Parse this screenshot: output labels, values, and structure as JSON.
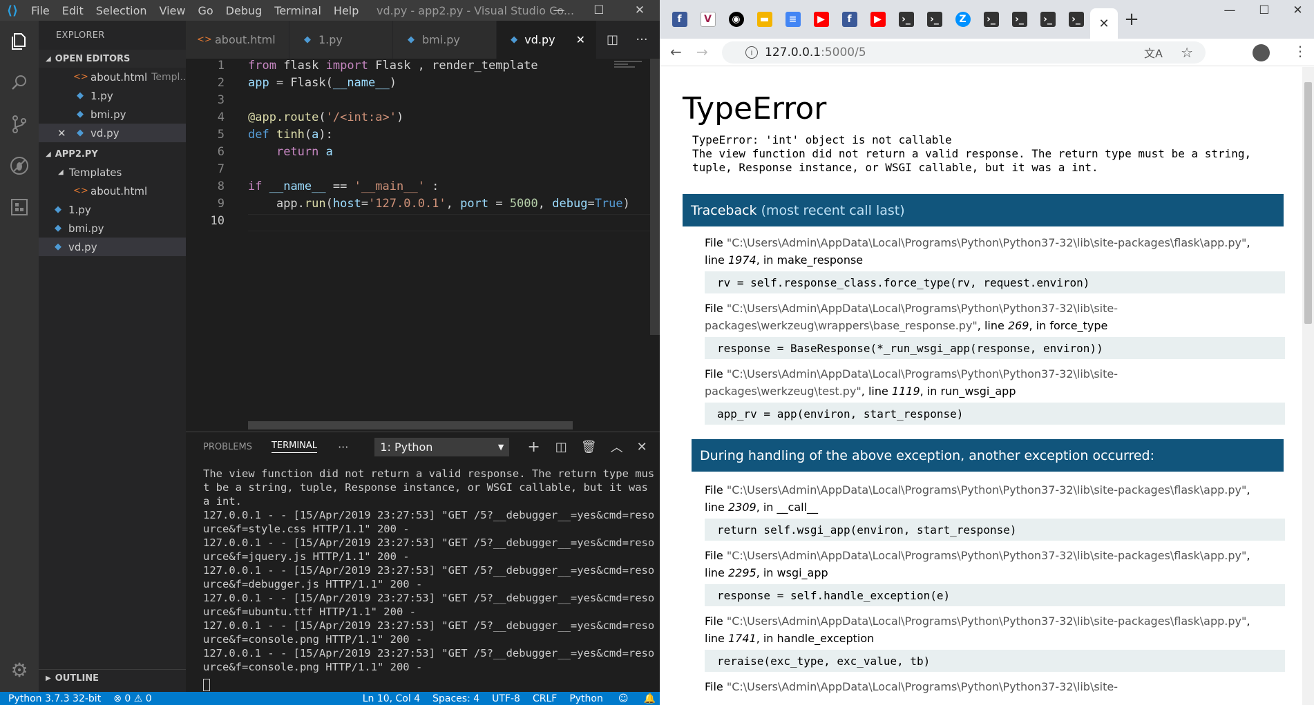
{
  "vscode": {
    "menu": [
      "File",
      "Edit",
      "Selection",
      "View",
      "Go",
      "Debug",
      "Terminal",
      "Help"
    ],
    "title": "vd.py - app2.py - Visual Studio Co...",
    "explorer_label": "EXPLORER",
    "open_editors_label": "OPEN EDITORS",
    "open_editors": [
      {
        "name": "about.html",
        "hint": "Templ..."
      },
      {
        "name": "1.py"
      },
      {
        "name": "bmi.py"
      },
      {
        "name": "vd.py"
      }
    ],
    "project_label": "APP2.PY",
    "tree": [
      {
        "name": "Templates"
      },
      {
        "name": "about.html"
      },
      {
        "name": "1.py"
      },
      {
        "name": "bmi.py"
      },
      {
        "name": "vd.py"
      }
    ],
    "outline_label": "OUTLINE",
    "tabs": [
      "about.html",
      "1.py",
      "bmi.py",
      "vd.py"
    ],
    "line_numbers": [
      "1",
      "2",
      "3",
      "4",
      "5",
      "6",
      "7",
      "8",
      "9",
      "10"
    ],
    "panel_tabs": [
      "PROBLEMS",
      "TERMINAL"
    ],
    "terminal_select": "1: Python",
    "terminal_text": "The view function did not return a valid response. The return type mus\nt be a string, tuple, Response instance, or WSGI callable, but it was\na int.\n127.0.0.1 - - [15/Apr/2019 23:27:53] \"GET /5?__debugger__=yes&cmd=reso\nurce&f=style.css HTTP/1.1\" 200 -\n127.0.0.1 - - [15/Apr/2019 23:27:53] \"GET /5?__debugger__=yes&cmd=reso\nurce&f=jquery.js HTTP/1.1\" 200 -\n127.0.0.1 - - [15/Apr/2019 23:27:53] \"GET /5?__debugger__=yes&cmd=reso\nurce&f=debugger.js HTTP/1.1\" 200 -\n127.0.0.1 - - [15/Apr/2019 23:27:53] \"GET /5?__debugger__=yes&cmd=reso\nurce&f=ubuntu.ttf HTTP/1.1\" 200 -\n127.0.0.1 - - [15/Apr/2019 23:27:53] \"GET /5?__debugger__=yes&cmd=reso\nurce&f=console.png HTTP/1.1\" 200 -\n127.0.0.1 - - [15/Apr/2019 23:27:53] \"GET /5?__debugger__=yes&cmd=reso\nurce&f=console.png HTTP/1.1\" 200 -",
    "status": {
      "python": "Python 3.7.3 32-bit",
      "errors": "0",
      "warnings": "0",
      "position": "Ln 10, Col 4",
      "spaces": "Spaces: 4",
      "encoding": "UTF-8",
      "eol": "CRLF",
      "lang": "Python"
    }
  },
  "chrome": {
    "url_host": "127.0.0.1",
    "url_path": ":5000/5",
    "page": {
      "title": "TypeError",
      "message": "TypeError: 'int' object is not callable\nThe view function did not return a valid response. The return type must be a string,\ntuple, Response instance, or WSGI callable, but it was a int.",
      "traceback_title": "Traceback",
      "traceback_sub": "(most recent call last)",
      "during": "During handling of the above exception, another exception occurred:",
      "frames": [
        {
          "pre": "File ",
          "path": "\"C:\\Users\\Admin\\AppData\\Local\\Programs\\Python\\Python37-32\\lib\\site-packages\\flask\\app.py\"",
          "mid": ",\nline ",
          "line": "1974",
          "post": ", in make_response",
          "src": "rv = self.response_class.force_type(rv, request.environ)"
        },
        {
          "pre": "File ",
          "path": "\"C:\\Users\\Admin\\AppData\\Local\\Programs\\Python\\Python37-32\\lib\\site-\npackages\\werkzeug\\wrappers\\base_response.py\"",
          "mid": ", line ",
          "line": "269",
          "post": ", in force_type",
          "src": "response = BaseResponse(*_run_wsgi_app(response, environ))"
        },
        {
          "pre": "File ",
          "path": "\"C:\\Users\\Admin\\AppData\\Local\\Programs\\Python\\Python37-32\\lib\\site-\npackages\\werkzeug\\test.py\"",
          "mid": ", line ",
          "line": "1119",
          "post": ", in run_wsgi_app",
          "src": "app_rv = app(environ, start_response)"
        },
        {
          "pre": "File ",
          "path": "\"C:\\Users\\Admin\\AppData\\Local\\Programs\\Python\\Python37-32\\lib\\site-packages\\flask\\app.py\"",
          "mid": ",\nline ",
          "line": "2309",
          "post": ", in __call__",
          "src": "return self.wsgi_app(environ, start_response)"
        },
        {
          "pre": "File ",
          "path": "\"C:\\Users\\Admin\\AppData\\Local\\Programs\\Python\\Python37-32\\lib\\site-packages\\flask\\app.py\"",
          "mid": ",\nline ",
          "line": "2295",
          "post": ", in wsgi_app",
          "src": "response = self.handle_exception(e)"
        },
        {
          "pre": "File ",
          "path": "\"C:\\Users\\Admin\\AppData\\Local\\Programs\\Python\\Python37-32\\lib\\site-packages\\flask\\app.py\"",
          "mid": ",\nline ",
          "line": "1741",
          "post": ", in handle_exception",
          "src": "reraise(exc_type, exc_value, tb)"
        },
        {
          "pre": "File ",
          "path": "\"C:\\Users\\Admin\\AppData\\Local\\Programs\\Python\\Python37-32\\lib\\site-",
          "mid": "",
          "line": "",
          "post": "",
          "src": ""
        }
      ]
    }
  }
}
